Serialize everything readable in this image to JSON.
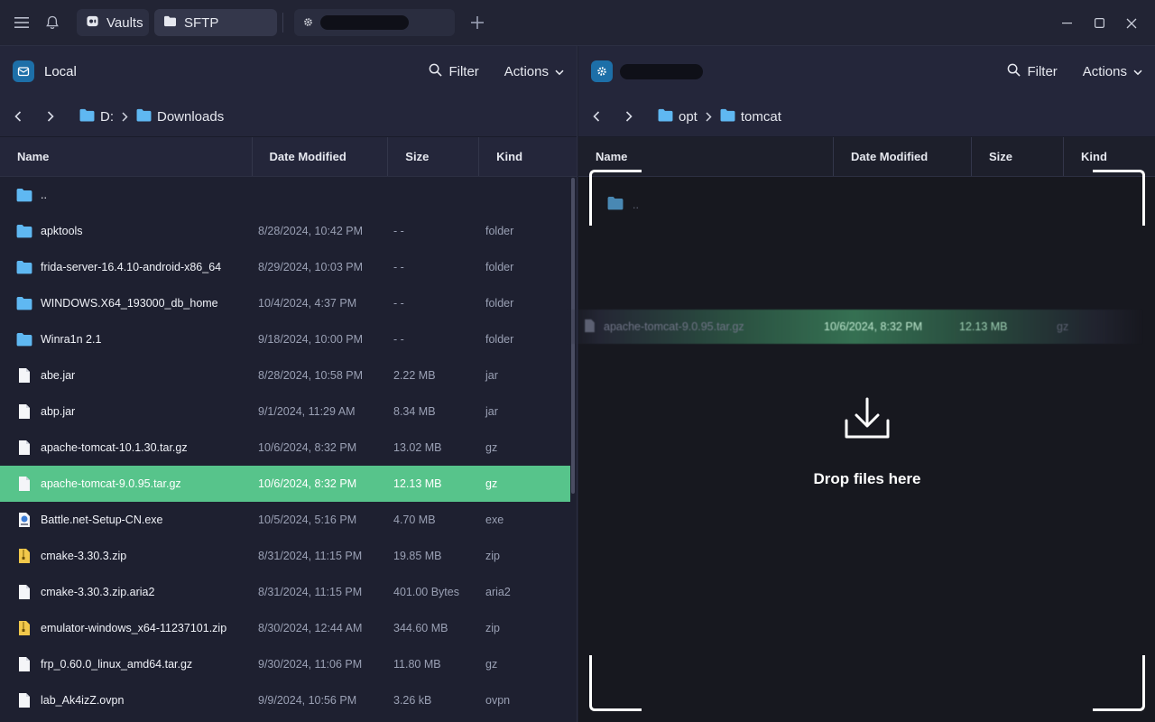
{
  "tabs": {
    "vaults_label": "Vaults",
    "sftp_label": "SFTP"
  },
  "left": {
    "title": "Local",
    "filter_label": "Filter",
    "actions_label": "Actions",
    "breadcrumb": [
      "D:",
      "Downloads"
    ],
    "columns": [
      "Name",
      "Date Modified",
      "Size",
      "Kind"
    ],
    "rows": [
      {
        "name": "..",
        "date": "",
        "size": "",
        "kind": "",
        "icon": "folder"
      },
      {
        "name": "apktools",
        "date": "8/28/2024, 10:42 PM",
        "size": "- -",
        "kind": "folder",
        "icon": "folder"
      },
      {
        "name": "frida-server-16.4.10-android-x86_64",
        "date": "8/29/2024, 10:03 PM",
        "size": "- -",
        "kind": "folder",
        "icon": "folder"
      },
      {
        "name": "WINDOWS.X64_193000_db_home",
        "date": "10/4/2024, 4:37 PM",
        "size": "- -",
        "kind": "folder",
        "icon": "folder"
      },
      {
        "name": "Winra1n 2.1",
        "date": "9/18/2024, 10:00 PM",
        "size": "- -",
        "kind": "folder",
        "icon": "folder"
      },
      {
        "name": "abe.jar",
        "date": "8/28/2024, 10:58 PM",
        "size": "2.22 MB",
        "kind": "jar",
        "icon": "file"
      },
      {
        "name": "abp.jar",
        "date": "9/1/2024, 11:29 AM",
        "size": "8.34 MB",
        "kind": "jar",
        "icon": "file"
      },
      {
        "name": "apache-tomcat-10.1.30.tar.gz",
        "date": "10/6/2024, 8:32 PM",
        "size": "13.02 MB",
        "kind": "gz",
        "icon": "file"
      },
      {
        "name": "apache-tomcat-9.0.95.tar.gz",
        "date": "10/6/2024, 8:32 PM",
        "size": "12.13 MB",
        "kind": "gz",
        "icon": "file",
        "selected": true
      },
      {
        "name": "Battle.net-Setup-CN.exe",
        "date": "10/5/2024, 5:16 PM",
        "size": "4.70 MB",
        "kind": "exe",
        "icon": "exe"
      },
      {
        "name": "cmake-3.30.3.zip",
        "date": "8/31/2024, 11:15 PM",
        "size": "19.85 MB",
        "kind": "zip",
        "icon": "zip"
      },
      {
        "name": "cmake-3.30.3.zip.aria2",
        "date": "8/31/2024, 11:15 PM",
        "size": "401.00 Bytes",
        "kind": "aria2",
        "icon": "file"
      },
      {
        "name": "emulator-windows_x64-11237101.zip",
        "date": "8/30/2024, 12:44 AM",
        "size": "344.60 MB",
        "kind": "zip",
        "icon": "zip"
      },
      {
        "name": "frp_0.60.0_linux_amd64.tar.gz",
        "date": "9/30/2024, 11:06 PM",
        "size": "11.80 MB",
        "kind": "gz",
        "icon": "file"
      },
      {
        "name": "lab_Ak4izZ.ovpn",
        "date": "9/9/2024, 10:56 PM",
        "size": "3.26 kB",
        "kind": "ovpn",
        "icon": "file"
      }
    ]
  },
  "right": {
    "filter_label": "Filter",
    "actions_label": "Actions",
    "breadcrumb": [
      "opt",
      "tomcat"
    ],
    "columns": [
      "Name",
      "Date Modified",
      "Size",
      "Kind"
    ],
    "parent_label": "..",
    "drag": {
      "name": "apache-tomcat-9.0.95.tar.gz",
      "date": "10/6/2024, 8:32 PM",
      "size": "12.13 MB",
      "kind": "gz"
    },
    "drop_text": "Drop files here"
  },
  "colors": {
    "selected_row": "#57c48b",
    "folder": "#5fb8f2",
    "host_icon": "#1d6fa8"
  }
}
